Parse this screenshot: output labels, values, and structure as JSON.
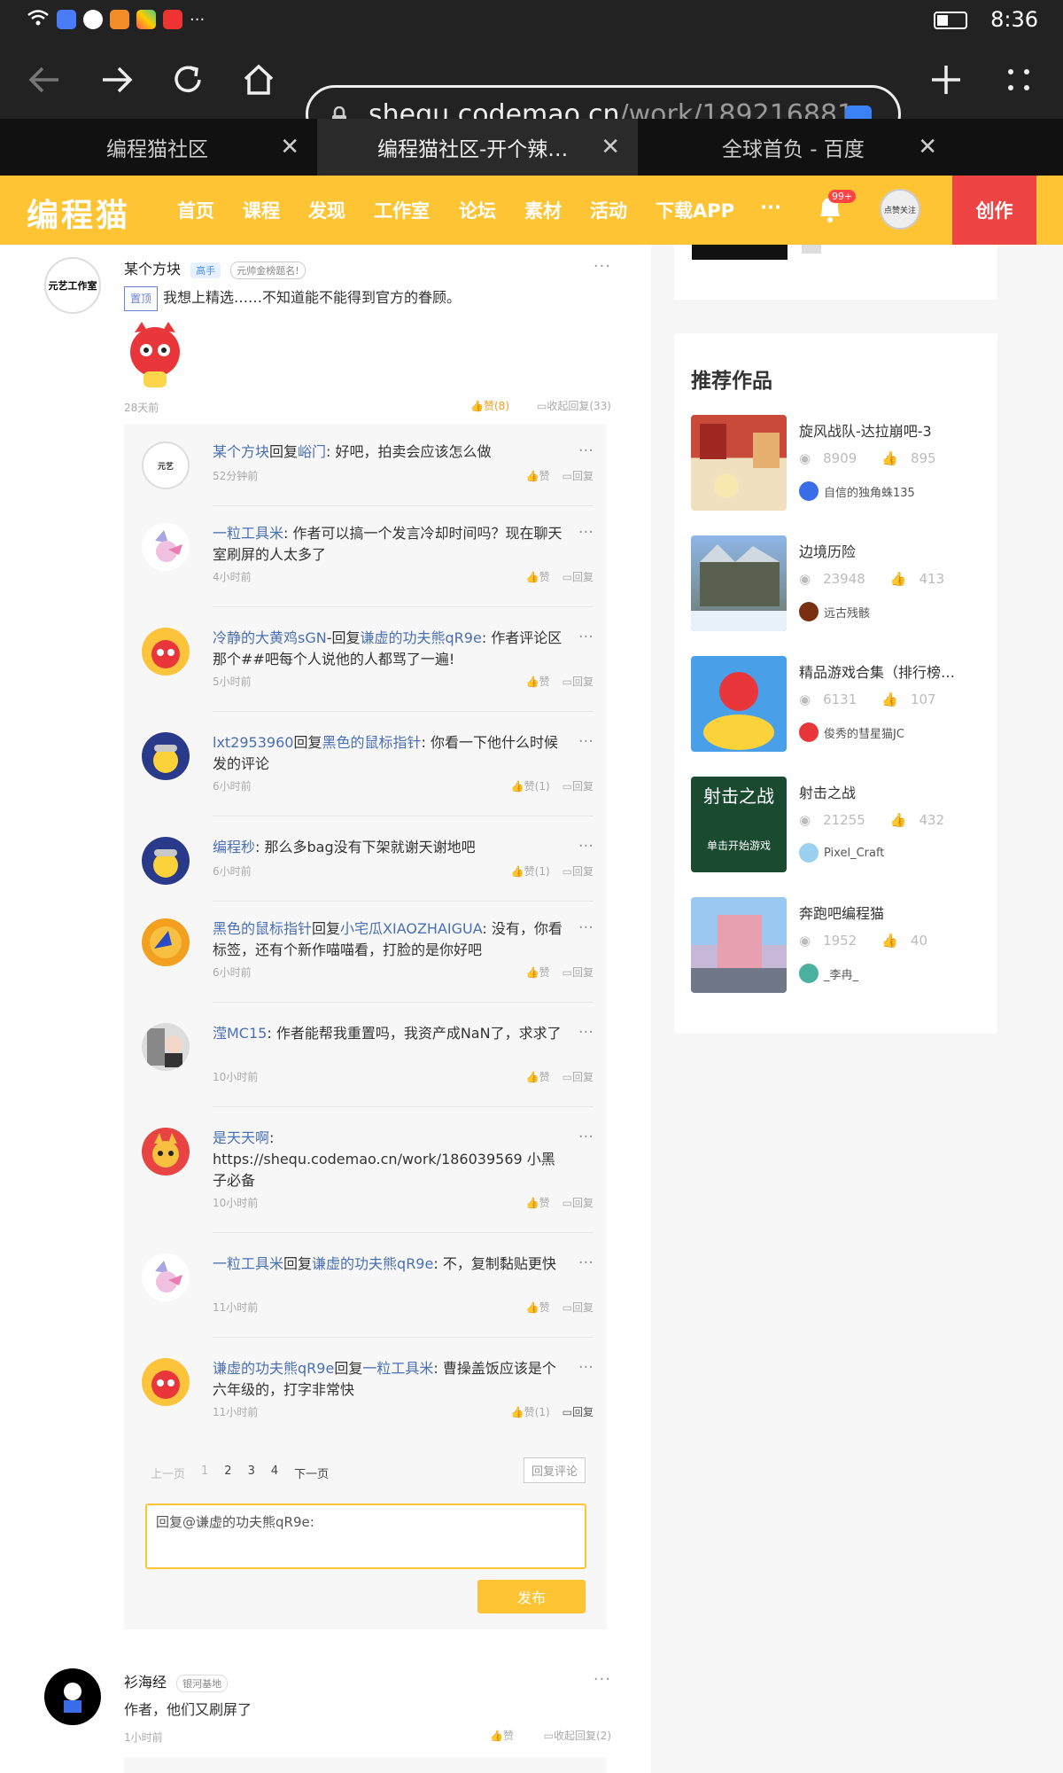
{
  "status": {
    "time": "8:36",
    "more": "···"
  },
  "browser": {
    "url_host": "shequ.codemao.cn",
    "url_path": "/work/189216881",
    "tabs": [
      {
        "label": "编程猫社区"
      },
      {
        "label": "编程猫社区-开个辣…"
      },
      {
        "label": "全球首负 - 百度"
      }
    ]
  },
  "nav": {
    "logo": "编程猫",
    "items": [
      "首页",
      "课程",
      "发现",
      "工作室",
      "论坛",
      "素材",
      "活动",
      "下载APP"
    ],
    "more": "···",
    "badge": "99+",
    "avatar_text": "点赞关注",
    "create": "创作"
  },
  "top_comment": {
    "user": "某个方块",
    "level": "高手",
    "badge": "元帅金榜题名!",
    "pin": "置顶",
    "text": "我想上精选……不知道能不能得到官方的眷顾。",
    "time": "28天前",
    "likes": "赞(8)",
    "collapse": "收起回复(33)",
    "avatar_text": "元艺工作室"
  },
  "replies": [
    {
      "user": "某个方块",
      "verb": "回复",
      "target": "峪门",
      "text": "好吧，拍卖会应该怎么做",
      "time": "52分钟前",
      "like": "赞",
      "reply": "回复"
    },
    {
      "user": "一粒工具米",
      "verb": "",
      "target": "",
      "text": "作者可以搞一个发言冷却时间吗？现在聊天室刷屏的人太多了",
      "time": "4小时前",
      "like": "赞",
      "reply": "回复"
    },
    {
      "user": "冷静的大黄鸡sGN",
      "verb": "-回复",
      "target": "谦虚的功夫熊qR9e",
      "text": "作者评论区那个##吧每个人说他的人都骂了一遍!",
      "time": "5小时前",
      "like": "赞",
      "reply": "回复"
    },
    {
      "user": "lxt2953960",
      "verb": "回复",
      "target": "黑色的鼠标指针",
      "text": "你看一下他什么时候发的评论",
      "time": "6小时前",
      "like": "赞(1)",
      "reply": "回复"
    },
    {
      "user": "编程秒",
      "verb": "",
      "target": "",
      "text": "那么多bag没有下架就谢天谢地吧",
      "time": "6小时前",
      "like": "赞(1)",
      "reply": "回复"
    },
    {
      "user": "黑色的鼠标指针",
      "verb": "回复",
      "target": "小宅瓜XIAOZHAIGUA",
      "text": "没有，你看标签，还有个新作喵喵看，打脸的是你好吧",
      "time": "6小时前",
      "like": "赞",
      "reply": "回复"
    },
    {
      "user": "滢MC15",
      "verb": "",
      "target": "",
      "text": "作者能帮我重置吗，我资产成NaN了，求求了",
      "time": "10小时前",
      "like": "赞",
      "reply": "回复"
    },
    {
      "user": "是天天啊",
      "verb": "",
      "target": "",
      "text": "https://shequ.codemao.cn/work/186039569 小黑子必备",
      "time": "10小时前",
      "like": "赞",
      "reply": "回复"
    },
    {
      "user": "一粒工具米",
      "verb": "回复",
      "target": "谦虚的功夫熊qR9e",
      "text": "不，复制黏贴更快",
      "time": "11小时前",
      "like": "赞",
      "reply": "回复"
    },
    {
      "user": "谦虚的功夫熊qR9e",
      "verb": "回复",
      "target": "一粒工具米",
      "text": "曹操盖饭应该是个六年级的，打字非常快",
      "time": "11小时前",
      "like": "赞(1)",
      "reply": "回复"
    }
  ],
  "pager": {
    "prev": "上一页",
    "p1": "1",
    "p2": "2",
    "p3": "3",
    "p4": "4",
    "next": "下一页",
    "reply_comment": "回复评论"
  },
  "reply_box": {
    "value": "回复@谦虚的功夫熊qR9e:",
    "publish": "发布"
  },
  "second_comment": {
    "user": "衫海经",
    "level": "银河基地",
    "text": "作者，他们又刷屏了",
    "time": "1小时前",
    "like": "赞",
    "collapse": "收起回复(2)"
  },
  "recommend": {
    "title": "推荐作品",
    "works": [
      {
        "title": "旋风战队-达拉崩吧-3",
        "views": "8909",
        "likes": "895",
        "author": "自信的独角蛛135"
      },
      {
        "title": "边境历险",
        "views": "23948",
        "likes": "413",
        "author": "远古残骸"
      },
      {
        "title": "精品游戏合集（排行榜…",
        "views": "6131",
        "likes": "107",
        "author": "俊秀的彗星猫JC"
      },
      {
        "title": "射击之战",
        "views": "21255",
        "likes": "432",
        "author": "Pixel_Craft",
        "thumb_title": "射击之战",
        "thumb_sub": "单击开始游戏"
      },
      {
        "title": "奔跑吧编程猫",
        "views": "1952",
        "likes": "40",
        "author": "_李冉_"
      }
    ]
  }
}
